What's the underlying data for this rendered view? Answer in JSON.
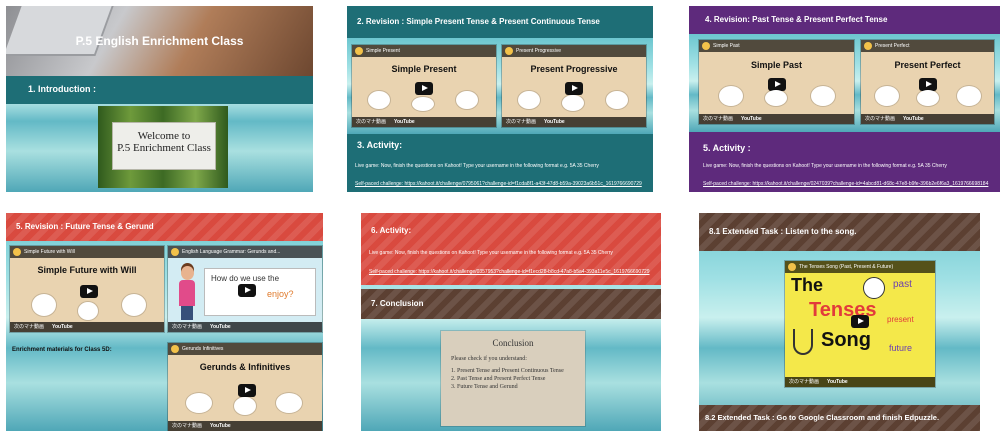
{
  "tile1": {
    "title": "P.5 English Enrichment Class",
    "section": "1. Introduction :",
    "welcome_line1": "Welcome to",
    "welcome_line2": "P.5 Enrichment Class"
  },
  "tile2": {
    "section": "2. Revision : Simple Present Tense & Present Continuous Tense",
    "video1_channel": "Simple Present",
    "video1_title": "Simple Present",
    "video2_channel": "Present Progressive",
    "video2_title": "Present Progressive",
    "footer_label": "次のマナ動画",
    "youtube": "YouTube",
    "activity": "3. Activity:",
    "kahoot_text": "Live game: Now, finish the questions on Kahoot! Type your username in the following format e.g. 5A 35 Cherry",
    "self_paced": "Self-paced challenge: https://kahoot.it/challenge/0795061?challenge-id=f1cda8f1-a43f-47d8-b59a-39023a6b51c_1619766690729"
  },
  "tile3": {
    "section": "4. Revision: Past Tense & Present Perfect Tense",
    "video1_channel": "Simple Past",
    "video1_title": "Simple Past",
    "video2_channel": "Present Perfect",
    "video2_title": "Present Perfect",
    "footer_label": "次のマナ動画",
    "youtube": "YouTube",
    "activity": "5. Activity :",
    "kahoot_text": "Live game: Now, finish the questions on Kahoot! Type your username in the following format e.g. 5A 35 Cherry",
    "self_paced": "Self-paced challenge: https://kahoot.it/challenge/0247039?challenge-id=4abcd81-d68c-47e8-b9fe-396b2e6f6a3_1619766698184"
  },
  "tile4": {
    "section": "5. Revision : Future Tense & Gerund",
    "video1_channel": "Simple Future with Will",
    "video1_title": "Simple Future with Will",
    "video2_channel": "English Language Grammar: Gerunds and...",
    "video2_question": "How do we use the",
    "video2_word": "enjoy?",
    "materials": "Enrichment materials for Class 5D:",
    "video3_channel": "Gerunds Infinitives",
    "video3_title": "Gerunds & Infinitives",
    "footer_label": "次のマナ動画",
    "youtube": "YouTube"
  },
  "tile5": {
    "activity": "6. Activity:",
    "kahoot_text": "Live game: Now, finish the questions on Kahoot! Type your username in the following format e.g. 5A 35 Cherry",
    "self_paced": "Self-paced challenge: https://kahoot.it/challenge/0357953?challenge-id=f1ecd28-b8cd-47a8-b5a4-393a11e5c_1619766690729",
    "conclusion": "7. Conclusion",
    "card_title": "Conclusion",
    "card_intro": "Please check if you understand:",
    "card_items": [
      "1. Present Tense and Present Continuous Tense",
      "2. Past Tense and Present Perfect Tense",
      "3. Future Tense and Gerund"
    ]
  },
  "tile6": {
    "section": "8.1 Extended Task : Listen to the song.",
    "video_channel": "The Tenses Song (Past, Present & Future)",
    "word_the": "The",
    "word_tenses": "Tenses",
    "word_song": "Song",
    "word_past": "past",
    "word_present": "present",
    "word_future": "future",
    "footer_label": "次のマナ動画",
    "youtube": "YouTube",
    "task2": "8.2 Extended Task : Go to Google Classroom and finish Edpuzzle."
  }
}
